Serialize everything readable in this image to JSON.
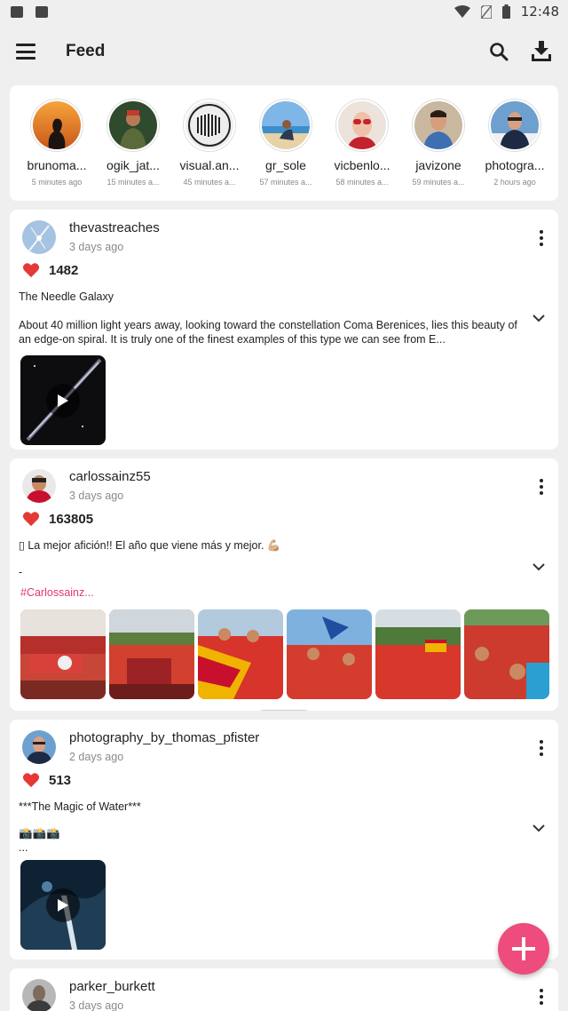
{
  "status_bar": {
    "time": "12:48"
  },
  "app_bar": {
    "title": "Feed"
  },
  "stories": [
    {
      "name": "brunoma...",
      "time": "5 minutes ago"
    },
    {
      "name": "ogik_jat...",
      "time": "15 minutes a..."
    },
    {
      "name": "visual.an...",
      "time": "45 minutes a..."
    },
    {
      "name": "gr_sole",
      "time": "57 minutes a..."
    },
    {
      "name": "vicbenlo...",
      "time": "58 minutes a..."
    },
    {
      "name": "javizone",
      "time": "59 minutes a..."
    },
    {
      "name": "photogra...",
      "time": "2 hours ago"
    }
  ],
  "posts": [
    {
      "username": "thevastreaches",
      "time": "3 days ago",
      "likes": "1482",
      "title": "The Needle Galaxy",
      "description": "About 40 million light years away, looking toward the constellation Coma Berenices, lies this beauty of an edge-on spiral.  It is truly one of the finest examples of this type we can see from E..."
    },
    {
      "username": "carlossainz55",
      "time": "3 days ago",
      "likes": "163805",
      "title": "▯ La mejor afición!! El año que viene más y mejor. 💪🏼",
      "description": "-",
      "hashtag": "#Carlossainz..."
    },
    {
      "username": "photography_by_thomas_pfister",
      "time": "2 days ago",
      "likes": "513",
      "title": "***The Magic of Water***",
      "description": "📸📸📸\n..."
    },
    {
      "username": "parker_burkett",
      "time": "3 days ago"
    }
  ],
  "colors": {
    "accent": "#ee4c7d",
    "heart": "#e53935",
    "hashtag": "#e2386b"
  }
}
